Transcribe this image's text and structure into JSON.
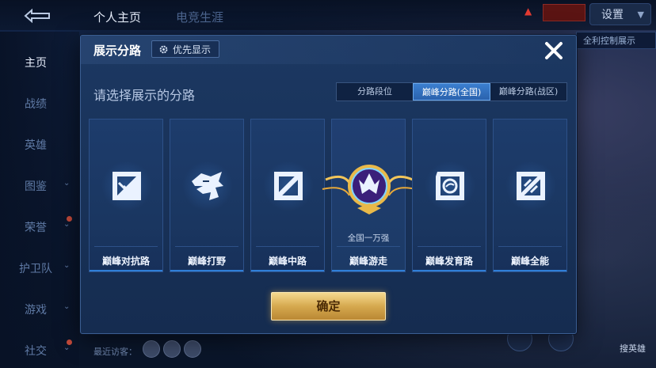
{
  "topbar": {
    "tabs": [
      "个人主页",
      "电竞生涯"
    ],
    "notice": "",
    "settings_label": "设置",
    "right_strip": "全利控制展示"
  },
  "sidenav": {
    "items": [
      {
        "label": "主页",
        "active": true
      },
      {
        "label": "战绩"
      },
      {
        "label": "英雄"
      },
      {
        "label": "图鉴"
      },
      {
        "label": "荣誉"
      },
      {
        "label": "护卫队"
      },
      {
        "label": "游戏"
      },
      {
        "label": "社交"
      }
    ]
  },
  "bottom": {
    "recent_label": "最近访客：",
    "right_label": "搜英雄"
  },
  "modal": {
    "title": "展示分路",
    "priority_label": "优先显示",
    "subtitle": "请选择展示的分路",
    "tabs": [
      {
        "label": "分路段位",
        "active": false
      },
      {
        "label": "巅峰分路(全国)",
        "active": true
      },
      {
        "label": "巅峰分路(战区)",
        "active": false
      }
    ],
    "cards": [
      {
        "name": "巅峰对抗路",
        "icon": "sword-icon",
        "rank": ""
      },
      {
        "name": "巅峰打野",
        "icon": "dragon-icon",
        "rank": ""
      },
      {
        "name": "巅峰中路",
        "icon": "staff-icon",
        "rank": ""
      },
      {
        "name": "巅峰游走",
        "icon": "support-emblem-icon",
        "rank": "全国一万强"
      },
      {
        "name": "巅峰发育路",
        "icon": "archer-icon",
        "rank": ""
      },
      {
        "name": "巅峰全能",
        "icon": "all-round-icon",
        "rank": ""
      }
    ],
    "confirm_label": "确定"
  },
  "colors": {
    "accent_blue": "#2f7fd8",
    "gold": "#d6a94f"
  }
}
